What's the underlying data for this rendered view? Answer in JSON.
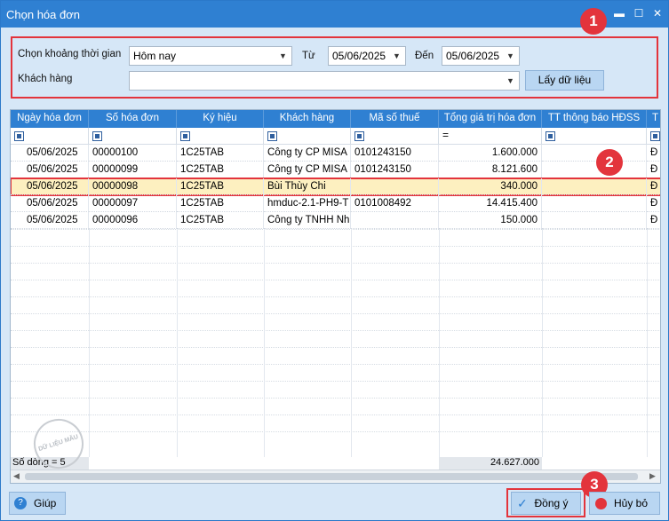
{
  "window": {
    "title": "Chọn hóa đơn"
  },
  "filter": {
    "period_label": "Chọn khoảng thời gian",
    "period_value": "Hôm nay",
    "from_label": "Từ",
    "from_value": "05/06/2025",
    "to_label": "Đến",
    "to_value": "05/06/2025",
    "customer_label": "Khách hàng",
    "customer_value": "",
    "fetch_button": "Lấy dữ liệu"
  },
  "grid": {
    "columns": [
      "Ngày hóa đơn",
      "Số hóa đơn",
      "Ký hiệu",
      "Khách hàng",
      "Mã số thuế",
      "Tổng giá trị hóa đơn",
      "TT thông báo HĐSS",
      "T"
    ],
    "filter_ops": [
      "",
      "",
      "",
      "",
      "",
      "=",
      "",
      ""
    ],
    "rows": [
      [
        "05/06/2025",
        "00000100",
        "1C25TAB",
        "Công ty CP MISA",
        "0101243150",
        "1.600.000",
        "",
        "Đ"
      ],
      [
        "05/06/2025",
        "00000099",
        "1C25TAB",
        "Công ty CP MISA",
        "0101243150",
        "8.121.600",
        "",
        "Đ"
      ],
      [
        "05/06/2025",
        "00000098",
        "1C25TAB",
        "Bùi Thùy Chi",
        "",
        "340.000",
        "",
        "Đ"
      ],
      [
        "05/06/2025",
        "00000097",
        "1C25TAB",
        "hmduc-2.1-PH9-T",
        "0101008492",
        "14.415.400",
        "",
        "Đ"
      ],
      [
        "05/06/2025",
        "00000096",
        "1C25TAB",
        "Công ty TNHH Nh",
        "",
        "150.000",
        "",
        "Đ"
      ]
    ],
    "row_count_label": "Số dòng = 5",
    "total_value": "24.627.000",
    "watermark": "DỮ LIỆU MẪU"
  },
  "footer": {
    "help_button": "Giúp",
    "ok_button": "Đồng ý",
    "cancel_button": "Hủy bỏ"
  },
  "badges": [
    "1",
    "2",
    "3"
  ],
  "colors": {
    "titlebar": "#2f80d2",
    "highlight": "#e3343c",
    "selected_row": "#fdf0c0",
    "dialog_bg": "#d6e7f7"
  }
}
